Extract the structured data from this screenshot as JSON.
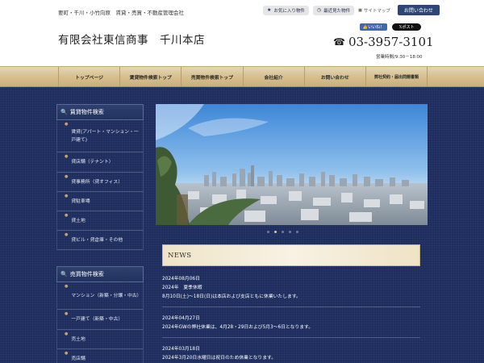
{
  "header": {
    "tagline": "要町・千川・小竹向原　賃貸・売買・不動産管理会社",
    "favorites_label": "お気に入り物件",
    "recent_label": "最近見た物件",
    "sitemap_label": "サイトマップ",
    "contact_label": "お問い合わせ",
    "company_name": "有限会社東信商事　千川本店",
    "fb_label": "いいね！",
    "x_label": "ポスト",
    "phone": "03-3957-3101",
    "hours": "営業時間/9:30－18:00"
  },
  "nav": {
    "items": [
      {
        "label": "トップページ"
      },
      {
        "label": "賃貸物件検索トップ"
      },
      {
        "label": "売買物件検索トップ"
      },
      {
        "label": "会社紹介"
      },
      {
        "label": "お問い合わせ"
      },
      {
        "label": "弊社契約・届出問題書類"
      }
    ]
  },
  "sidebar": {
    "rental": {
      "title": "賃貸物件検索",
      "items": [
        {
          "label": "賃貸(アパート・マンション・一戸建て)"
        },
        {
          "label": "貸店舗（テナント）"
        },
        {
          "label": "貸事務所（貸オフィス）"
        },
        {
          "label": "貸駐車場"
        },
        {
          "label": "貸土地"
        },
        {
          "label": "貸ビル・貸倉庫・その他"
        }
      ]
    },
    "sale": {
      "title": "売買物件検索",
      "items": [
        {
          "label": "マンション（新築・分譲・中古）"
        },
        {
          "label": "一戸建て（新築・中古）"
        },
        {
          "label": "売土地"
        },
        {
          "label": "売店舗"
        }
      ]
    }
  },
  "slider": {
    "dot_count": 5,
    "active_index": 1
  },
  "news": {
    "title": "NEWS",
    "items": [
      {
        "date": "2024年08月06日",
        "lines": [
          "2024年　夏季休暇",
          "8月10日(土)～18日(日)は本店および支店ともに休業いたします。"
        ]
      },
      {
        "date": "2024年04月27日",
        "lines": [
          "2024年GWの弊社休業は、4月28・29日および5月3～6日となります。"
        ]
      },
      {
        "date": "2024年03月18日",
        "lines": [
          "2024年3月20日水曜日は祝日のため休業となります。"
        ]
      }
    ]
  },
  "colors": {
    "navy": "#1d2d5e",
    "gold": "#d7c293",
    "contact_button": "#2d4677"
  }
}
